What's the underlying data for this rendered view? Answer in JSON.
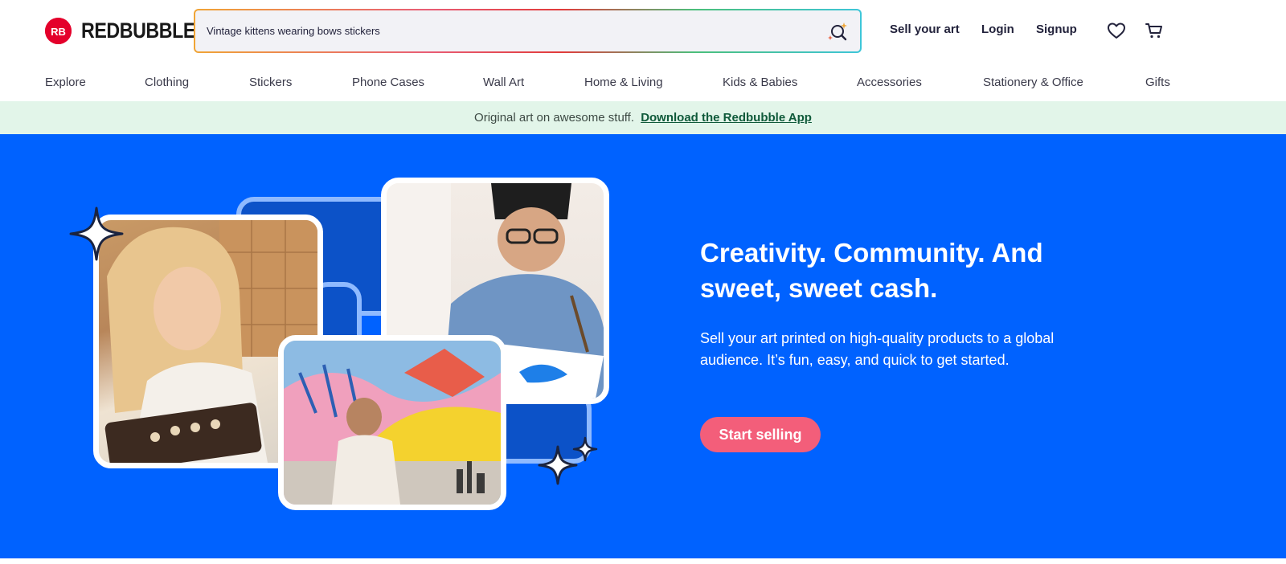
{
  "brand": {
    "name": "REDBUBBLE",
    "mark_color": "#e4002b"
  },
  "search": {
    "value": "Vintage kittens wearing bows stickers",
    "icon": "ai-search-icon"
  },
  "header": {
    "sell_label": "Sell your art",
    "login_label": "Login",
    "signup_label": "Signup",
    "wishlist_icon": "heart-icon",
    "cart_icon": "cart-icon"
  },
  "categories": [
    "Explore",
    "Clothing",
    "Stickers",
    "Phone Cases",
    "Wall Art",
    "Home & Living",
    "Kids & Babies",
    "Accessories",
    "Stationery & Office",
    "Gifts"
  ],
  "promo": {
    "text": "Original art on awesome stuff.",
    "link": "Download the Redbubble App",
    "background": "#e2f5e9"
  },
  "hero": {
    "title": "Creativity. Community. And sweet, sweet cash.",
    "subtitle": "Sell your art printed on high-quality products to a global audience. It’s fun, easy, and quick to get started.",
    "cta_label": "Start selling",
    "background": "#0062ff",
    "cta_color": "#f35e7a"
  }
}
